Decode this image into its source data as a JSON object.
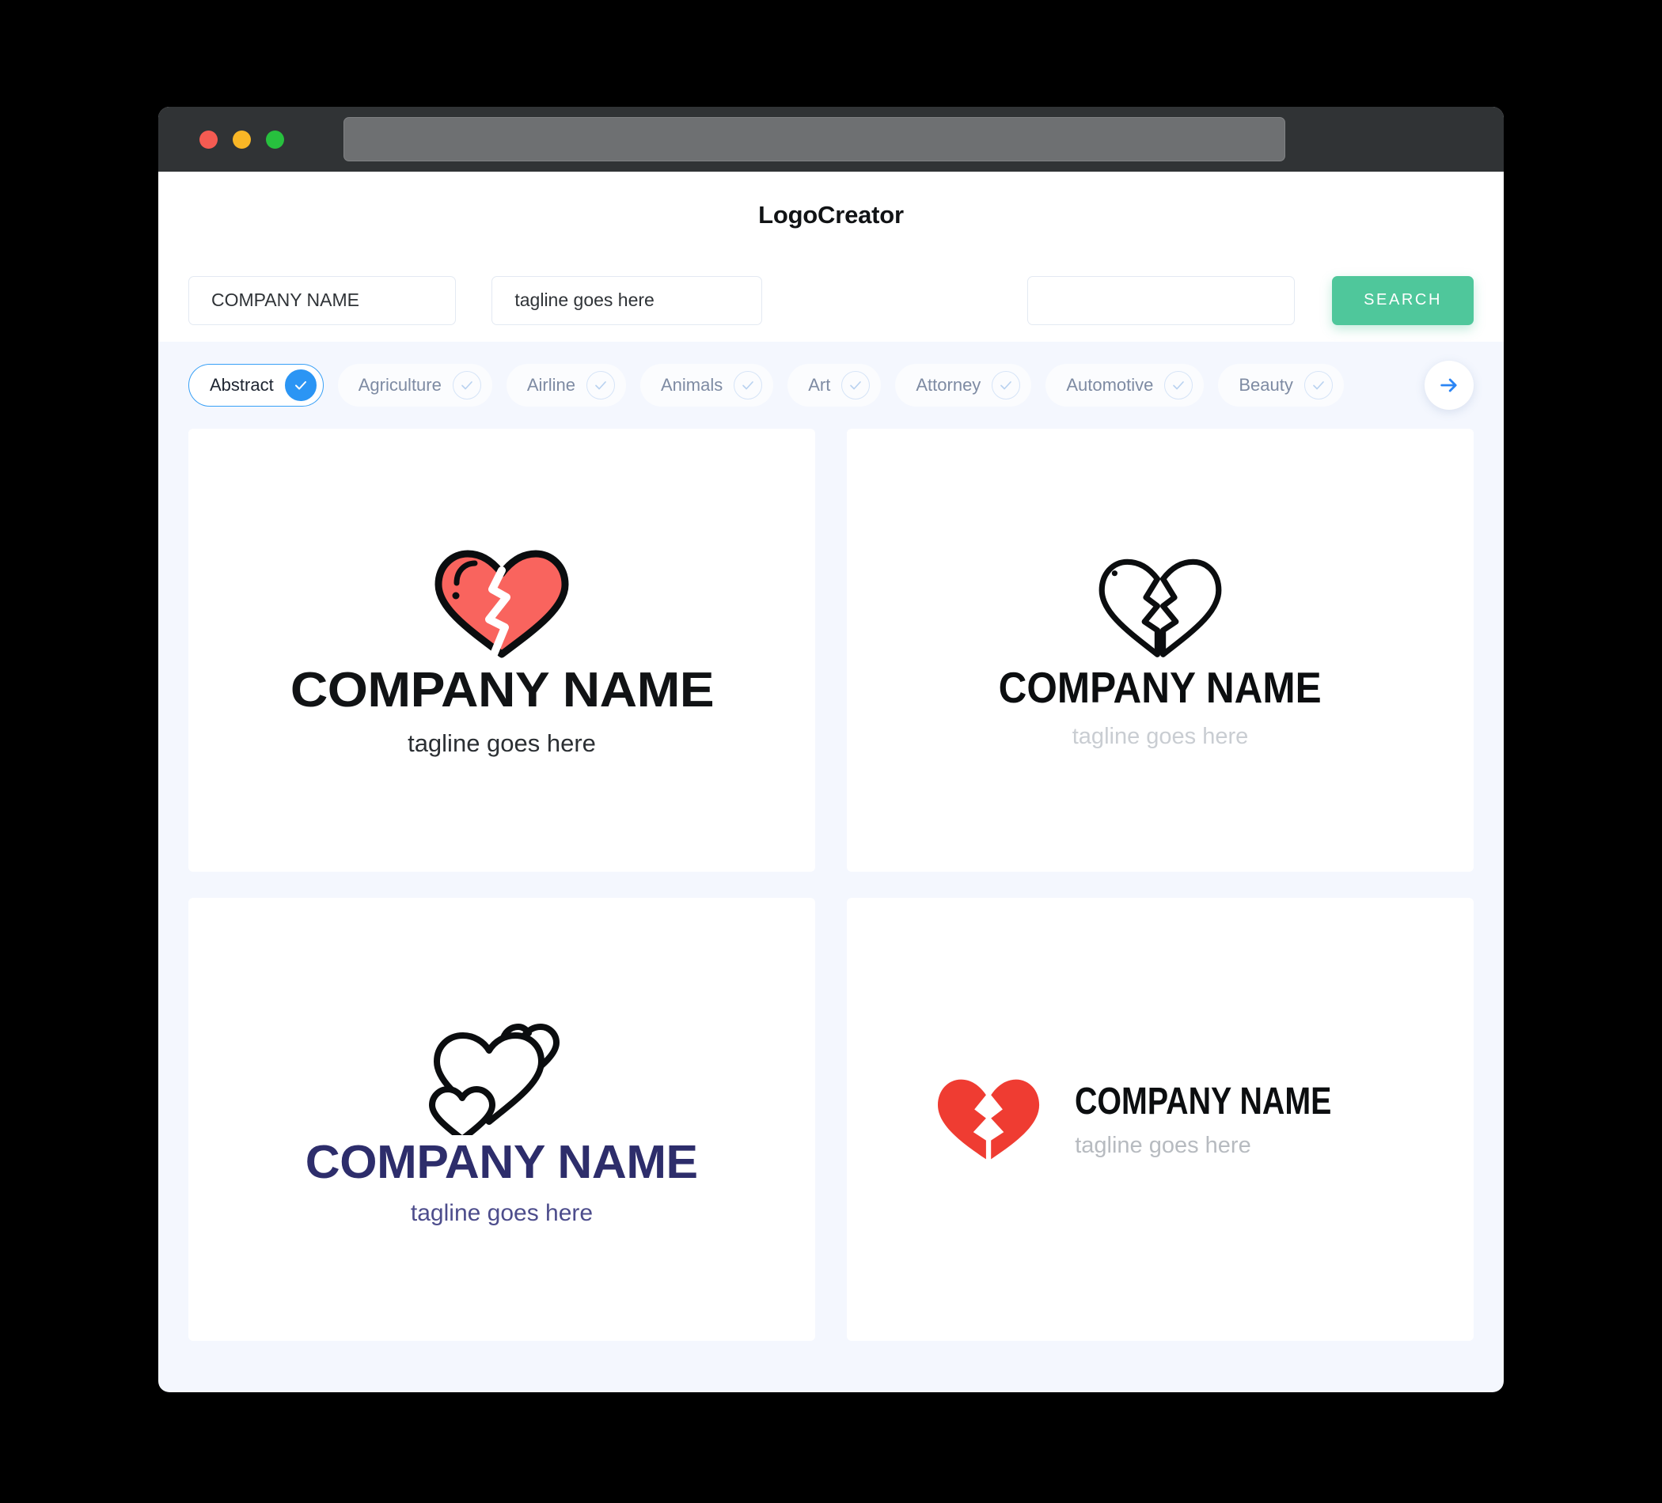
{
  "window": {
    "traffic_lights": [
      "close",
      "minimize",
      "maximize"
    ],
    "url_bar_value": "",
    "url_bar_placeholder": ""
  },
  "header": {
    "app_title": "LogoCreator"
  },
  "search": {
    "company_name_value": "COMPANY NAME",
    "company_name_placeholder": "COMPANY NAME",
    "tagline_value": "tagline goes here",
    "tagline_placeholder": "tagline goes here",
    "keyword_value": "",
    "keyword_placeholder": "",
    "search_button_label": "SEARCH"
  },
  "categories": {
    "next_icon": "arrow-right-icon",
    "items": [
      {
        "label": "Abstract",
        "selected": true,
        "check_icon": "check-icon"
      },
      {
        "label": "Agriculture",
        "selected": false,
        "check_icon": "check-icon"
      },
      {
        "label": "Airline",
        "selected": false,
        "check_icon": "check-icon"
      },
      {
        "label": "Animals",
        "selected": false,
        "check_icon": "check-icon"
      },
      {
        "label": "Art",
        "selected": false,
        "check_icon": "check-icon"
      },
      {
        "label": "Attorney",
        "selected": false,
        "check_icon": "check-icon"
      },
      {
        "label": "Automotive",
        "selected": false,
        "check_icon": "check-icon"
      },
      {
        "label": "Beauty",
        "selected": false,
        "check_icon": "check-icon"
      }
    ]
  },
  "colors": {
    "accent_blue": "#2b95f4",
    "search_green": "#4fc79b",
    "heart_coral": "#f9645e",
    "heart_red": "#ef3c32",
    "navy": "#2d2d6b",
    "page_bg": "#f4f7fe",
    "titlebar": "#303335"
  },
  "logos": [
    {
      "id": "card-1",
      "icon": "broken-heart-filled-outlined-icon",
      "layout": "stacked",
      "name": "COMPANY NAME",
      "tagline": "tagline goes here"
    },
    {
      "id": "card-2",
      "icon": "broken-heart-outline-icon",
      "layout": "stacked",
      "name": "COMPANY NAME",
      "tagline": "tagline goes here"
    },
    {
      "id": "card-3",
      "icon": "three-hearts-outline-icon",
      "layout": "stacked",
      "name": "COMPANY NAME",
      "tagline": "tagline goes here"
    },
    {
      "id": "card-4",
      "icon": "broken-heart-solid-red-icon",
      "layout": "horizontal",
      "name": "COMPANY NAME",
      "tagline": "tagline goes here"
    }
  ]
}
